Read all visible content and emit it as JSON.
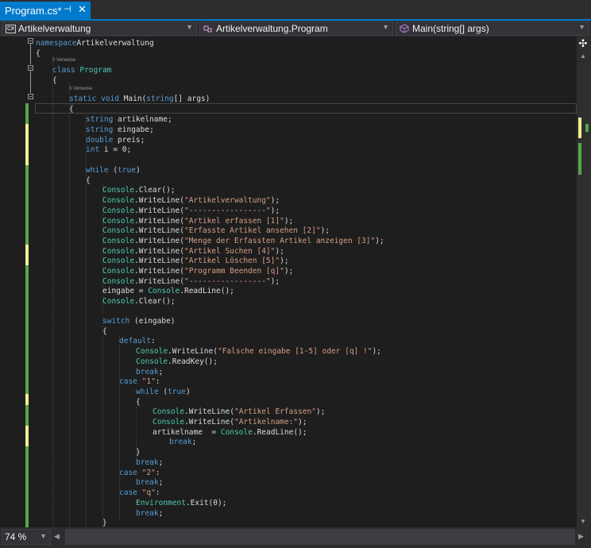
{
  "tab": {
    "title": "Program.cs*",
    "pin": "⊣",
    "close": "✕"
  },
  "nav": {
    "project": {
      "badge": "C#",
      "label": "Artikelverwaltung"
    },
    "type": {
      "label": "Artikelverwaltung.Program"
    },
    "member": {
      "label": "Main(string[] args)"
    }
  },
  "zoom": {
    "value": "74 %"
  },
  "references": [
    "0 Verweise",
    "0 Verweise"
  ],
  "colors": {
    "accent": "#007acc",
    "keyword": "#569cd6",
    "type": "#4ec9b0",
    "string": "#d69d85",
    "text": "#dcdcdc",
    "change_saved": "#57a64a",
    "change_unsaved": "#efef91"
  },
  "code_lines": [
    [
      [
        "kw",
        "namespace"
      ],
      [
        "",
        "Artikelverwaltung"
      ]
    ],
    [
      [
        "",
        "{"
      ]
    ],
    [
      [
        "kw",
        "class"
      ],
      [
        "",
        " "
      ],
      [
        "cls",
        "Program"
      ]
    ],
    [
      [
        "",
        "{"
      ]
    ],
    [
      [
        "kw",
        "static"
      ],
      [
        "",
        " "
      ],
      [
        "kw",
        "void"
      ],
      [
        "",
        " Main("
      ],
      [
        "kw",
        "string"
      ],
      [
        "",
        "[] args)"
      ]
    ],
    [
      [
        "",
        "{"
      ]
    ],
    [
      [
        "kw",
        "string"
      ],
      [
        "",
        " artikelname;"
      ]
    ],
    [
      [
        "kw",
        "string"
      ],
      [
        "",
        " eingabe;"
      ]
    ],
    [
      [
        "kw",
        "double"
      ],
      [
        "",
        " preis;"
      ]
    ],
    [
      [
        "kw",
        "int"
      ],
      [
        "",
        " i = 0;"
      ]
    ],
    [],
    [
      [
        "kw",
        "while"
      ],
      [
        "",
        " ("
      ],
      [
        "kw",
        "true"
      ],
      [
        "",
        ")"
      ]
    ],
    [
      [
        "",
        "{"
      ]
    ],
    [
      [
        "cls",
        "Console"
      ],
      [
        "",
        ".Clear();"
      ]
    ],
    [
      [
        "cls",
        "Console"
      ],
      [
        "",
        ".WriteLine("
      ],
      [
        "str",
        "\"Artikelverwaltung\""
      ],
      [
        "",
        ");"
      ]
    ],
    [
      [
        "cls",
        "Console"
      ],
      [
        "",
        ".WriteLine("
      ],
      [
        "str",
        "\"-----------------\""
      ],
      [
        "",
        ");"
      ]
    ],
    [
      [
        "cls",
        "Console"
      ],
      [
        "",
        ".WriteLine("
      ],
      [
        "str",
        "\"Artikel erfassen [1]\""
      ],
      [
        "",
        ");"
      ]
    ],
    [
      [
        "cls",
        "Console"
      ],
      [
        "",
        ".WriteLine("
      ],
      [
        "str",
        "\"Erfasste Artikel ansehen [2]\""
      ],
      [
        "",
        ");"
      ]
    ],
    [
      [
        "cls",
        "Console"
      ],
      [
        "",
        ".WriteLine("
      ],
      [
        "str",
        "\"Menge der Erfassten Artikel anzeigen [3]\""
      ],
      [
        "",
        ");"
      ]
    ],
    [
      [
        "cls",
        "Console"
      ],
      [
        "",
        ".WriteLine("
      ],
      [
        "str",
        "\"Artikel Suchen [4]\""
      ],
      [
        "",
        ");"
      ]
    ],
    [
      [
        "cls",
        "Console"
      ],
      [
        "",
        ".WriteLine("
      ],
      [
        "str",
        "\"Artikel Löschen [5]\""
      ],
      [
        "",
        ");"
      ]
    ],
    [
      [
        "cls",
        "Console"
      ],
      [
        "",
        ".WriteLine("
      ],
      [
        "str",
        "\"Programm Beenden [q]\""
      ],
      [
        "",
        ");"
      ]
    ],
    [
      [
        "cls",
        "Console"
      ],
      [
        "",
        ".WriteLine("
      ],
      [
        "str",
        "\"-----------------\""
      ],
      [
        "",
        ");"
      ]
    ],
    [
      [
        "",
        "eingabe = "
      ],
      [
        "cls",
        "Console"
      ],
      [
        "",
        ".ReadLine();"
      ]
    ],
    [
      [
        "cls",
        "Console"
      ],
      [
        "",
        ".Clear();"
      ]
    ],
    [],
    [
      [
        "kw",
        "switch"
      ],
      [
        "",
        " (eingabe)"
      ]
    ],
    [
      [
        "",
        "{"
      ]
    ],
    [
      [
        "kw",
        "default"
      ],
      [
        "",
        ":"
      ]
    ],
    [
      [
        "cls",
        "Console"
      ],
      [
        "",
        ".WriteLine("
      ],
      [
        "str",
        "\"Falsche eingabe [1-5] oder [q] !\""
      ],
      [
        "",
        ");"
      ]
    ],
    [
      [
        "cls",
        "Console"
      ],
      [
        "",
        ".ReadKey();"
      ]
    ],
    [
      [
        "kw",
        "break"
      ],
      [
        "",
        ";"
      ]
    ],
    [
      [
        "kw",
        "case"
      ],
      [
        "",
        " "
      ],
      [
        "str",
        "\"1\""
      ],
      [
        "",
        ":"
      ]
    ],
    [
      [
        "kw",
        "while"
      ],
      [
        "",
        " ("
      ],
      [
        "kw",
        "true"
      ],
      [
        "",
        ")"
      ]
    ],
    [
      [
        "",
        "{"
      ]
    ],
    [
      [
        "cls",
        "Console"
      ],
      [
        "",
        ".WriteLine("
      ],
      [
        "str",
        "\"Artikel Erfassen\""
      ],
      [
        "",
        ");"
      ]
    ],
    [
      [
        "cls",
        "Console"
      ],
      [
        "",
        ".WriteLine("
      ],
      [
        "str",
        "\"Artikelname:\""
      ],
      [
        "",
        ");"
      ]
    ],
    [
      [
        "",
        "artikelname  = "
      ],
      [
        "cls",
        "Console"
      ],
      [
        "",
        ".ReadLine();"
      ]
    ],
    [
      [
        "kw",
        "break"
      ],
      [
        "",
        ";"
      ]
    ],
    [
      [
        "",
        "}"
      ]
    ],
    [
      [
        "kw",
        "break"
      ],
      [
        "",
        ";"
      ]
    ],
    [
      [
        "kw",
        "case"
      ],
      [
        "",
        " "
      ],
      [
        "str",
        "\"2\""
      ],
      [
        "",
        ":"
      ]
    ],
    [
      [
        "kw",
        "break"
      ],
      [
        "",
        ";"
      ]
    ],
    [
      [
        "kw",
        "case"
      ],
      [
        "",
        " "
      ],
      [
        "str",
        "\"q\""
      ],
      [
        "",
        ":"
      ]
    ],
    [
      [
        "cls",
        "Environment"
      ],
      [
        "",
        ".Exit(0);"
      ]
    ],
    [
      [
        "kw",
        "break"
      ],
      [
        "",
        ";"
      ]
    ],
    [
      [
        "",
        "}"
      ]
    ],
    [
      [
        "",
        "}"
      ]
    ]
  ]
}
